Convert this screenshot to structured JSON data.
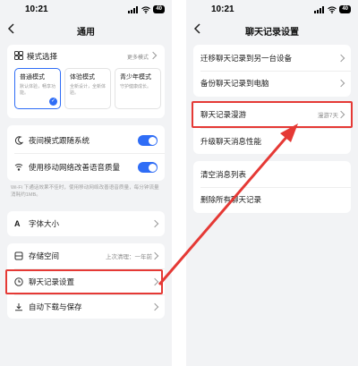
{
  "left": {
    "status": {
      "time": "10:21",
      "battery": "40"
    },
    "title": "通用",
    "modes": {
      "label": "模式选择",
      "more": "更多模式",
      "cards": [
        {
          "title": "普通模式",
          "desc": "默认体验，畅享功能。",
          "selected": true
        },
        {
          "title": "体验模式",
          "desc": "全新设计，全新体验。",
          "selected": false
        },
        {
          "title": "青少年模式",
          "desc": "守护健康成长。",
          "selected": false
        }
      ]
    },
    "night_label": "夜间模式跟随系统",
    "voice_label": "使用移动网络改善语音质量",
    "voice_hint": "Wi-Fi 下通话效果不佳时，使用移动网络改善语音质量，每分钟流量消耗约1MB。",
    "font_label": "字体大小",
    "storage_label": "存储空间",
    "storage_value": "上次清理：一年前",
    "chat_history_label": "聊天记录设置",
    "auto_download_label": "自动下载与保存"
  },
  "right": {
    "status": {
      "time": "10:21",
      "battery": "40"
    },
    "title": "聊天记录设置",
    "migrate_label": "迁移聊天记录到另一台设备",
    "backup_label": "备份聊天记录到电脑",
    "roam_label": "聊天记录漫游",
    "roam_value": "漫游7天",
    "upgrade_label": "升级聊天消息性能",
    "clear_label": "清空消息列表",
    "delete_label": "删除所有聊天记录"
  },
  "colors": {
    "accent": "#2f6df6",
    "highlight": "#e53935"
  }
}
